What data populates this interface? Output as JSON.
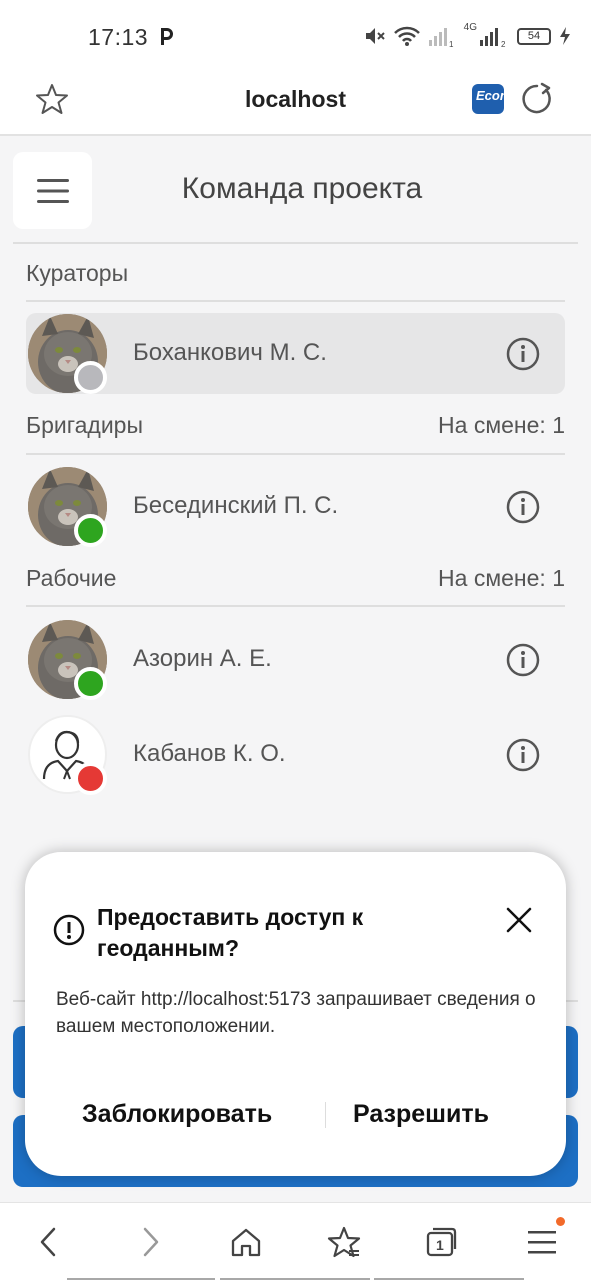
{
  "status_bar": {
    "time": "17:13",
    "network_label": "4G",
    "battery": "54"
  },
  "browser": {
    "url": "localhost",
    "extension_label": "Econ"
  },
  "header": {
    "title": "Команда проекта"
  },
  "sections": {
    "curators": {
      "title": "Кураторы"
    },
    "foremen": {
      "title": "Бригадиры",
      "on_shift": "На смене: 1"
    },
    "workers": {
      "title": "Рабочие",
      "on_shift": "На смене: 1"
    }
  },
  "members": [
    {
      "name": "Боханкович М. С.",
      "status": "offline",
      "status_color": "#b8b8bc",
      "selected": true
    },
    {
      "name": "Бесединский П. С.",
      "status": "online",
      "status_color": "#2ea51f"
    },
    {
      "name": "Азорин А. Е.",
      "status": "online",
      "status_color": "#2ea51f"
    },
    {
      "name": "Кабанов К. О.",
      "status": "busy",
      "status_color": "#e53935"
    }
  ],
  "dialog": {
    "title": "Предоставить доступ к геоданным?",
    "body": "Веб-сайт http://localhost:5173 запрашивает сведения о вашем местоположении.",
    "block_label": "Заблокировать",
    "allow_label": "Разрешить"
  },
  "nav": {
    "tabs_count": "1"
  },
  "colors": {
    "accent": "#1d6fc4",
    "online": "#2ea51f",
    "offline": "#b8b8bc",
    "busy": "#e53935"
  }
}
